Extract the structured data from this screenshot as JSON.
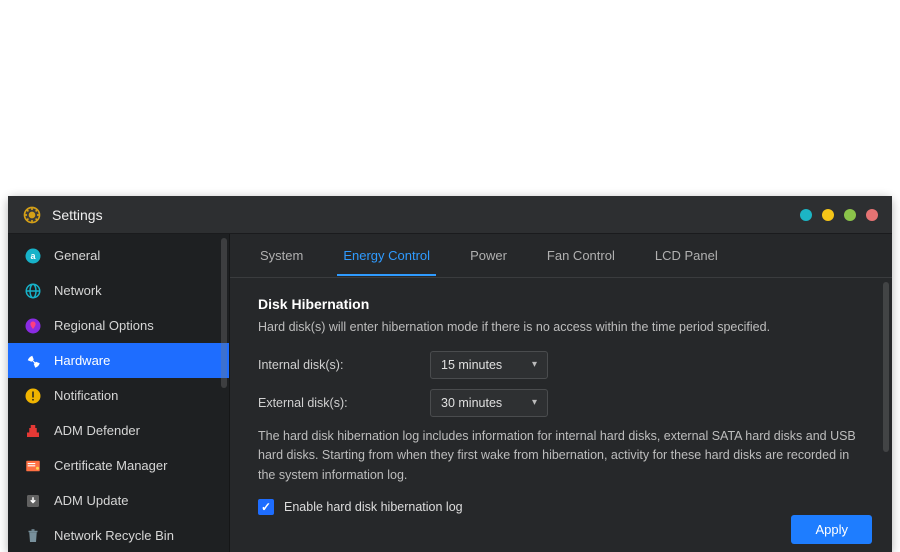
{
  "title": "Settings",
  "traffic_colors": [
    "teal",
    "yellow",
    "green",
    "red"
  ],
  "sidebar": {
    "items": [
      {
        "label": "General",
        "icon": "general"
      },
      {
        "label": "Network",
        "icon": "network"
      },
      {
        "label": "Regional Options",
        "icon": "regional"
      },
      {
        "label": "Hardware",
        "icon": "hardware",
        "active": true
      },
      {
        "label": "Notification",
        "icon": "notification"
      },
      {
        "label": "ADM Defender",
        "icon": "defender"
      },
      {
        "label": "Certificate Manager",
        "icon": "certificate"
      },
      {
        "label": "ADM Update",
        "icon": "update"
      },
      {
        "label": "Network Recycle Bin",
        "icon": "recycle"
      }
    ]
  },
  "tabs": [
    {
      "label": "System"
    },
    {
      "label": "Energy Control",
      "active": true
    },
    {
      "label": "Power"
    },
    {
      "label": "Fan Control"
    },
    {
      "label": "LCD Panel"
    }
  ],
  "energy": {
    "section_title": "Disk Hibernation",
    "description": "Hard disk(s) will enter hibernation mode if there is no access within the time period specified.",
    "internal_label": "Internal disk(s):",
    "internal_value": "15 minutes",
    "external_label": "External disk(s):",
    "external_value": "30 minutes",
    "log_info": "The hard disk hibernation log includes information for internal hard disks, external SATA hard disks and USB hard disks. Starting from when they first wake from hibernation, activity for these hard disks are recorded in the system information log.",
    "checkbox_label": "Enable hard disk hibernation log",
    "checkbox_checked": true
  },
  "apply_label": "Apply"
}
